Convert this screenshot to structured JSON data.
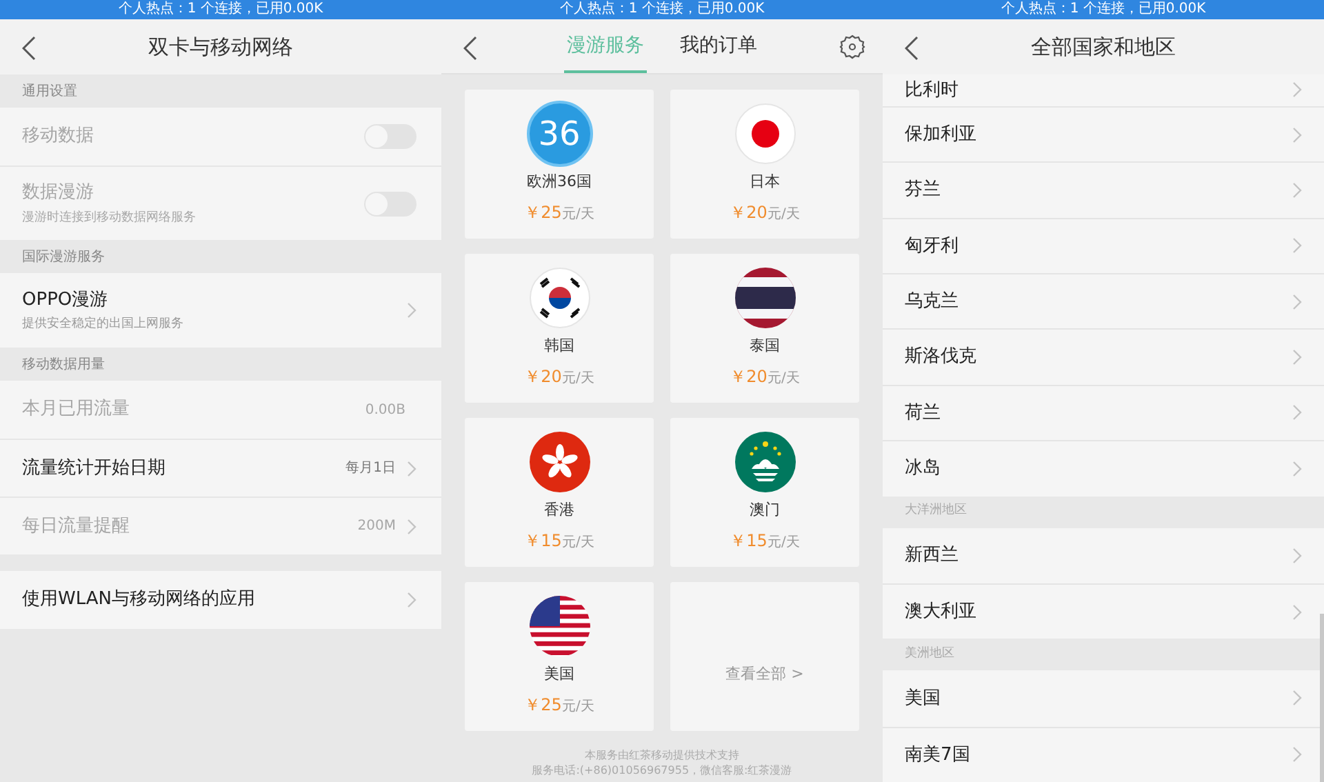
{
  "settings_screen": {
    "status_bar": "个人热点：1 个连接，已用0.00K",
    "title": "双卡与移动网络",
    "sections": [
      {
        "header": "通用设置",
        "rows": [
          {
            "kind": "toggle",
            "label": "移动数据",
            "disabled": true,
            "on": false
          },
          {
            "kind": "toggle",
            "label": "数据漫游",
            "subtitle": "漫游时连接到移动数据网络服务",
            "disabled": true,
            "on": false
          }
        ]
      },
      {
        "header": "国际漫游服务",
        "rows": [
          {
            "kind": "link",
            "label": "OPPO漫游",
            "subtitle": "提供安全稳定的出国上网服务",
            "disabled": false
          }
        ]
      },
      {
        "header": "移动数据用量",
        "rows": [
          {
            "kind": "value",
            "label": "本月已用流量",
            "value": "0.00B",
            "disabled": true
          },
          {
            "kind": "link",
            "label": "流量统计开始日期",
            "value": "每月1日",
            "disabled": false
          },
          {
            "kind": "link",
            "label": "每日流量提醒",
            "value": "200M",
            "disabled": true
          }
        ]
      },
      {
        "rows": [
          {
            "kind": "link",
            "label": "使用WLAN与移动网络的应用",
            "disabled": false
          }
        ]
      }
    ]
  },
  "roaming_screen": {
    "status_bar": "个人热点：1 个连接，已用0.00K",
    "tabs": [
      {
        "label": "漫游服务",
        "selected": true
      },
      {
        "label": "我的订单",
        "selected": false
      }
    ],
    "cards": [
      {
        "kind": "europe",
        "badge": "36",
        "name": "欧洲36国",
        "price": "￥25",
        "unit": "元/天"
      },
      {
        "kind": "japan",
        "name": "日本",
        "price": "￥20",
        "unit": "元/天"
      },
      {
        "kind": "korea",
        "name": "韩国",
        "price": "￥20",
        "unit": "元/天"
      },
      {
        "kind": "thailand",
        "name": "泰国",
        "price": "￥20",
        "unit": "元/天"
      },
      {
        "kind": "hongkong",
        "name": "香港",
        "price": "￥15",
        "unit": "元/天"
      },
      {
        "kind": "macau",
        "name": "澳门",
        "price": "￥15",
        "unit": "元/天"
      },
      {
        "kind": "usa",
        "name": "美国",
        "price": "￥25",
        "unit": "元/天"
      },
      {
        "kind": "more",
        "label": "查看全部 >"
      }
    ],
    "footer": [
      "本服务由红茶移动提供技术支持",
      "服务电话:(+86)01056967955，微信客服:红茶漫游"
    ]
  },
  "regions_screen": {
    "status_bar": "个人热点：1 个连接，已用0.00K",
    "title": "全部国家和地区",
    "groups": [
      {
        "items": [
          "比利时",
          "保加利亚",
          "芬兰",
          "匈牙利",
          "乌克兰",
          "斯洛伐克",
          "荷兰",
          "冰岛"
        ]
      },
      {
        "header": "大洋洲地区",
        "items": [
          "新西兰",
          "澳大利亚"
        ]
      },
      {
        "header": "美洲地区",
        "items": [
          "美国",
          "南美7国"
        ]
      }
    ]
  }
}
